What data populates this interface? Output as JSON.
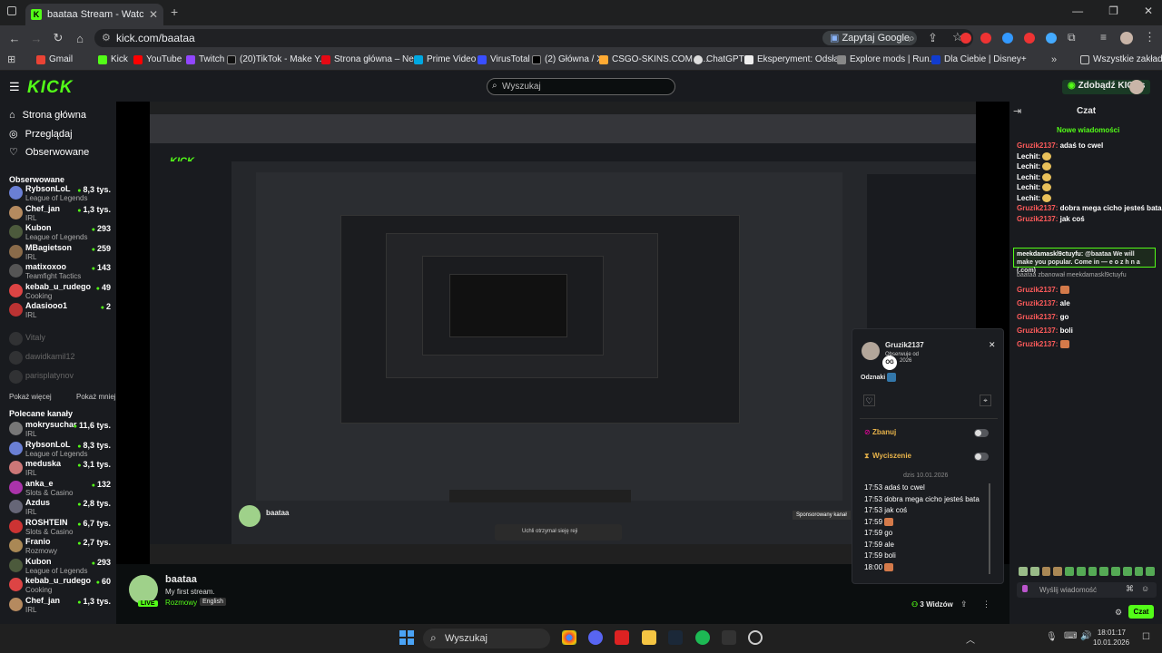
{
  "browser": {
    "tab_title": "baataa Stream - Watch Live on",
    "url": "kick.com/baataa",
    "zapytaj_google": "Zapytaj Google",
    "bookmarks": [
      "Gmail",
      "Kick",
      "YouTube",
      "Twitch",
      "(20)TikTok - Make Y...",
      "Strona główna – Ne...",
      "Prime Video",
      "VirusTotal",
      "(2) Główna / X",
      "CSGO-SKINS.COM - ...",
      "ChatGPT",
      "Eksperyment: Odsła...",
      "Explore mods | Run...",
      "Dla Ciebie | Disney+"
    ],
    "all_bookmarks": "Wszystkie zakładki"
  },
  "kick": {
    "logo": "KICK",
    "search_placeholder": "Wyszukaj",
    "get_kicks": "Zdobądź KICKs"
  },
  "sidebar": {
    "nav": [
      "Strona główna",
      "Przeglądaj",
      "Obserwowane"
    ],
    "followed_title": "Obserwowane",
    "followed": [
      {
        "name": "RybsonLoL",
        "game": "League of Legends",
        "viewers": "8,3 tys.",
        "color": "#6a7fd4"
      },
      {
        "name": "Chef_jan",
        "game": "IRL",
        "viewers": "1,3 tys.",
        "color": "#b58a5f"
      },
      {
        "name": "Kubon",
        "game": "League of Legends",
        "viewers": "293",
        "color": "#4c5a3c"
      },
      {
        "name": "MBagietson",
        "game": "IRL",
        "viewers": "259",
        "color": "#8a6b4a"
      },
      {
        "name": "matixoxoo",
        "game": "Teamfight Tactics",
        "viewers": "143",
        "color": "#555"
      },
      {
        "name": "kebab_u_rudego",
        "game": "Cooking",
        "viewers": "49",
        "color": "#d44"
      },
      {
        "name": "Adasiooo1",
        "game": "IRL",
        "viewers": "2",
        "color": "#b33"
      }
    ],
    "offline": [
      "Vitaly",
      "dawidkamil12",
      "parisplatynov"
    ],
    "show_more": "Pokaż więcej",
    "show_less": "Pokaż mniej",
    "recommended_title": "Polecane kanały",
    "recommended": [
      {
        "name": "mokrysuchar",
        "game": "IRL",
        "viewers": "11,6 tys.",
        "color": "#777"
      },
      {
        "name": "RybsonLoL",
        "game": "League of Legends",
        "viewers": "8,3 tys.",
        "color": "#6a7fd4"
      },
      {
        "name": "meduska",
        "game": "IRL",
        "viewers": "3,1 tys.",
        "color": "#c77"
      },
      {
        "name": "anka_e",
        "game": "Slots & Casino",
        "viewers": "132",
        "color": "#a3a"
      },
      {
        "name": "Azdus",
        "game": "IRL",
        "viewers": "2,8 tys.",
        "color": "#667"
      },
      {
        "name": "ROSHTEIN",
        "game": "Slots & Casino",
        "viewers": "6,7 tys.",
        "color": "#c33"
      },
      {
        "name": "Franio",
        "game": "Rozmowy",
        "viewers": "2,7 tys.",
        "color": "#a85"
      },
      {
        "name": "Kubon",
        "game": "League of Legends",
        "viewers": "293",
        "color": "#4c5a3c"
      },
      {
        "name": "kebab_u_rudego",
        "game": "Cooking",
        "viewers": "60",
        "color": "#d44"
      },
      {
        "name": "Chef_jan",
        "game": "IRL",
        "viewers": "1,3 tys.",
        "color": "#b58a5f"
      }
    ]
  },
  "stream": {
    "streamer": "baataa",
    "title": "My first stream.",
    "category": "Rozmowy",
    "language": "English",
    "toast": "Uchli otrzymał sieję reji"
  },
  "chat": {
    "title": "Czat",
    "new_messages": "Nowe wiadomości",
    "messages": [
      {
        "user": "Gruzik2137:",
        "text": "adaś to cwel",
        "red": true
      },
      {
        "user": "Lechit:",
        "text": "",
        "red": false,
        "emote": true
      },
      {
        "user": "Lechit:",
        "text": "",
        "red": false,
        "emote": true
      },
      {
        "user": "Lechit:",
        "text": "",
        "red": false,
        "emote": true
      },
      {
        "user": "Lechit:",
        "text": "",
        "red": false,
        "emote": true
      },
      {
        "user": "Lechit:",
        "text": "",
        "red": false,
        "emote": true
      },
      {
        "user": "Gruzik2137:",
        "text": "dobra mega cicho jesteś bata",
        "red": true
      },
      {
        "user": "Gruzik2137:",
        "text": "jak coś",
        "red": true
      }
    ],
    "highlight_user": "meekdamaskl9ctuyfu:",
    "highlight_text": "@baataa We will make you popular. Come in — e o z h n a (.com)",
    "reply_note": "baataa zbanował meekdamaskl9ctuyfu",
    "messages2": [
      {
        "user": "Gruzik2137:",
        "text": "",
        "emote": true
      },
      {
        "user": "Gruzik2137:",
        "text": "ale",
        "emote": false
      },
      {
        "user": "Gruzik2137:",
        "text": "go",
        "emote": false
      },
      {
        "user": "Gruzik2137:",
        "text": "boli",
        "emote": false
      },
      {
        "user": "Gruzik2137:",
        "text": "",
        "emote": true
      }
    ],
    "input_placeholder": "Wyślij wiadomość",
    "viewers": "3 Widzów",
    "send": "Czat"
  },
  "popup": {
    "username": "Gruzik2137",
    "followed_since": "Obserwuje od",
    "date_frag": "2026",
    "unfollow": "Odznaki",
    "ban": "Zbanuj",
    "mute": "Wyciszenie",
    "history_date": "dzis 10.01.2026",
    "history": [
      {
        "time": "17:53",
        "text": "adaś to cwel"
      },
      {
        "time": "17:53",
        "text": "dobra mega cicho jesteś bata"
      },
      {
        "time": "17:53",
        "text": "jak coś"
      },
      {
        "time": "17:59",
        "text": ""
      },
      {
        "time": "17:59",
        "text": "go"
      },
      {
        "time": "17:59",
        "text": "ale"
      },
      {
        "time": "17:59",
        "text": "boli"
      },
      {
        "time": "18:00",
        "text": ""
      }
    ]
  },
  "taskbar": {
    "search": "Wyszukaj",
    "time": "18:01:17",
    "date": "10.01.2026"
  },
  "colors": {
    "accent": "#53fc18",
    "sidebar": "#191b1f",
    "chat_user_red": "#ff5b5b"
  }
}
